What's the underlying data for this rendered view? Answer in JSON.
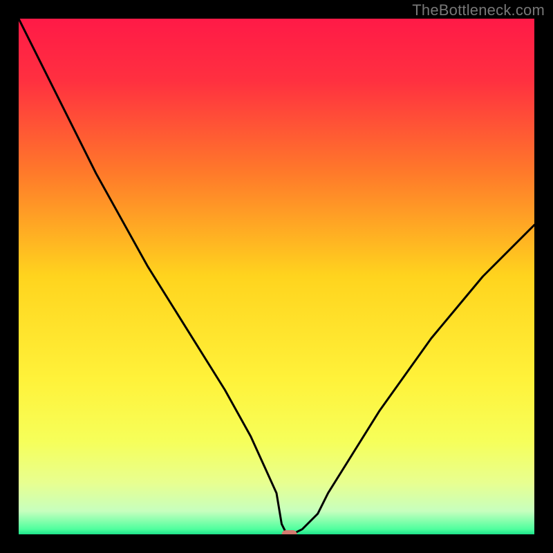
{
  "watermark": "TheBottleneck.com",
  "chart_data": {
    "type": "line",
    "title": "",
    "xlabel": "",
    "ylabel": "",
    "xlim": [
      0,
      100
    ],
    "ylim": [
      0,
      100
    ],
    "x": [
      0,
      5,
      10,
      15,
      20,
      25,
      30,
      35,
      40,
      45,
      50,
      51,
      52,
      53,
      55,
      58,
      60,
      65,
      70,
      75,
      80,
      85,
      90,
      95,
      100
    ],
    "y": [
      100,
      90,
      80,
      70,
      61,
      52,
      44,
      36,
      28,
      19,
      8,
      2,
      0,
      0,
      1,
      4,
      8,
      16,
      24,
      31,
      38,
      44,
      50,
      55,
      60
    ],
    "marker": {
      "x": 52.5,
      "y": 0
    },
    "gradient_stops": [
      {
        "pos": 0.0,
        "color": "#ff1a47"
      },
      {
        "pos": 0.12,
        "color": "#ff3040"
      },
      {
        "pos": 0.3,
        "color": "#ff7a2a"
      },
      {
        "pos": 0.5,
        "color": "#ffd41e"
      },
      {
        "pos": 0.7,
        "color": "#fff23a"
      },
      {
        "pos": 0.82,
        "color": "#f6ff5a"
      },
      {
        "pos": 0.9,
        "color": "#e8ff90"
      },
      {
        "pos": 0.955,
        "color": "#c7ffbe"
      },
      {
        "pos": 0.99,
        "color": "#4fff9e"
      },
      {
        "pos": 1.0,
        "color": "#1de28a"
      }
    ],
    "marker_color": "#d47a70",
    "line_color": "#000000"
  }
}
